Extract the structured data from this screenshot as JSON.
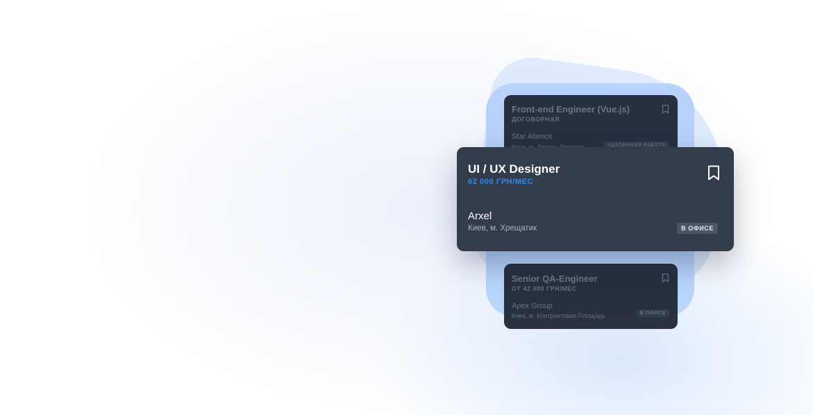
{
  "jobs": {
    "top": {
      "title": "Front-end Engineer (Vue.js)",
      "salary": "ДОГОВОРНАЯ",
      "company": "Star Alience",
      "location": "Киев, м. Дворец Украина",
      "badge": "УДАЛЕННАЯ РАБОТА"
    },
    "featured": {
      "title": "UI / UX Designer",
      "salary": "62 000 ГРН/МЕС",
      "company": "Arxel",
      "location": "Киев, м. Хрещатик",
      "badge": "В ОФИСЕ"
    },
    "bottom": {
      "title": "Senior QA-Engineer",
      "salary": "ОТ 42 000 ГРН/МЕС",
      "company": "Apex Group",
      "location": "Киев, м. Контрактовая Площадь",
      "badge": "В ОФИСЕ"
    }
  },
  "colors": {
    "accent": "#2e8bf2",
    "card_bg": "#323c4b",
    "card_dim_bg": "#1b2331",
    "blob": "#b9d3fb"
  },
  "icons": {
    "bookmark": "bookmark-icon"
  }
}
